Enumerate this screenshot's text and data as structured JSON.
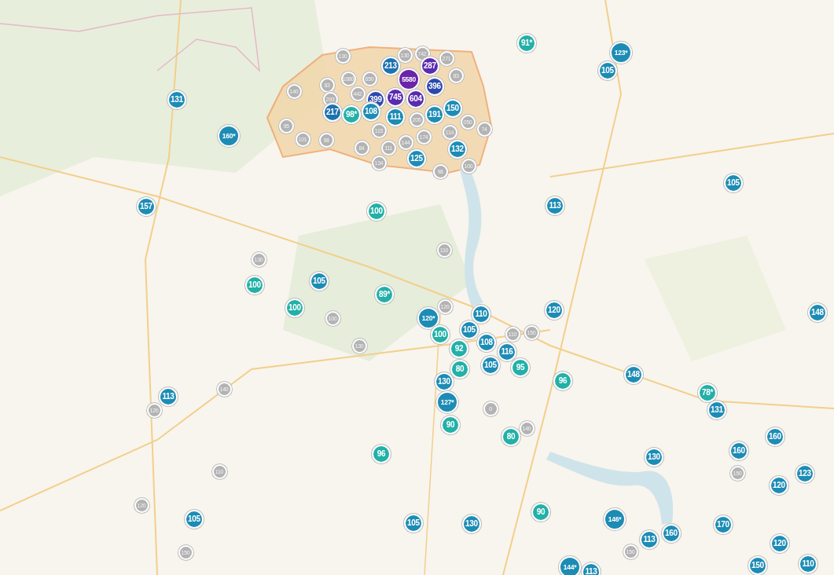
{
  "markers": [
    {
      "label": "131",
      "color": "#1d8cb5"
    },
    {
      "label": "160*",
      "color": "#1d8cb5"
    },
    {
      "label": "157",
      "color": "#1d8cb5"
    },
    {
      "label": "100",
      "color": "#22b0a7"
    },
    {
      "label": "130",
      "color": "#b3b3b3"
    },
    {
      "label": "100",
      "color": "#22b0a7"
    },
    {
      "label": "105",
      "color": "#1d8cb5"
    },
    {
      "label": "89*",
      "color": "#22b0a7"
    },
    {
      "label": "100",
      "color": "#22b0a7"
    },
    {
      "label": "100",
      "color": "#b3b3b3"
    },
    {
      "label": "130",
      "color": "#b3b3b3"
    },
    {
      "label": "130",
      "color": "#b3b3b3"
    },
    {
      "label": "130",
      "color": "#b3b3b3"
    },
    {
      "label": "742",
      "color": "#b3b3b3"
    },
    {
      "label": "271",
      "color": "#b3b3b3"
    },
    {
      "label": "83",
      "color": "#b3b3b3"
    },
    {
      "label": "83",
      "color": "#b3b3b3"
    },
    {
      "label": "1080",
      "color": "#b3b3b3"
    },
    {
      "label": "650",
      "color": "#b3b3b3"
    },
    {
      "label": "140",
      "color": "#b3b3b3"
    },
    {
      "label": "293",
      "color": "#b3b3b3"
    },
    {
      "label": "442",
      "color": "#b3b3b3"
    },
    {
      "label": "213",
      "color": "#1d72b0"
    },
    {
      "label": "399",
      "color": "#2c48ad"
    },
    {
      "label": "745",
      "color": "#5a2bb0"
    },
    {
      "label": "5580",
      "color": "#6a24a8"
    },
    {
      "label": "604",
      "color": "#5a2bb0"
    },
    {
      "label": "287",
      "color": "#5a2bb0"
    },
    {
      "label": "396",
      "color": "#2c48ad"
    },
    {
      "label": "217",
      "color": "#1d72b0"
    },
    {
      "label": "98*",
      "color": "#22b0a7"
    },
    {
      "label": "108",
      "color": "#1d8cb5"
    },
    {
      "label": "111",
      "color": "#1d8cb5"
    },
    {
      "label": "191",
      "color": "#1d8cb5"
    },
    {
      "label": "150",
      "color": "#1d8cb5"
    },
    {
      "label": "95",
      "color": "#b3b3b3"
    },
    {
      "label": "101",
      "color": "#b3b3b3"
    },
    {
      "label": "98",
      "color": "#b3b3b3"
    },
    {
      "label": "115",
      "color": "#b3b3b3"
    },
    {
      "label": "205",
      "color": "#b3b3b3"
    },
    {
      "label": "174",
      "color": "#b3b3b3"
    },
    {
      "label": "050",
      "color": "#b3b3b3"
    },
    {
      "label": "74",
      "color": "#b3b3b3"
    },
    {
      "label": "114",
      "color": "#b3b3b3"
    },
    {
      "label": "84",
      "color": "#b3b3b3"
    },
    {
      "label": "111",
      "color": "#b3b3b3"
    },
    {
      "label": "144",
      "color": "#b3b3b3"
    },
    {
      "label": "132",
      "color": "#1d8cb5"
    },
    {
      "label": "125",
      "color": "#1d8cb5"
    },
    {
      "label": "134",
      "color": "#b3b3b3"
    },
    {
      "label": "100",
      "color": "#b3b3b3"
    },
    {
      "label": "98",
      "color": "#b3b3b3"
    },
    {
      "label": "110",
      "color": "#b3b3b3"
    },
    {
      "label": "91*",
      "color": "#22b0a7"
    },
    {
      "label": "123*",
      "color": "#1d8cb5"
    },
    {
      "label": "105",
      "color": "#1d8cb5"
    },
    {
      "label": "105",
      "color": "#1d8cb5"
    },
    {
      "label": "113",
      "color": "#1d8cb5"
    },
    {
      "label": "120",
      "color": "#1d8cb5"
    },
    {
      "label": "148",
      "color": "#1d8cb5"
    },
    {
      "label": "120",
      "color": "#b3b3b3"
    },
    {
      "label": "120*",
      "color": "#1d8cb5"
    },
    {
      "label": "100",
      "color": "#22b0a7"
    },
    {
      "label": "110",
      "color": "#1d8cb5"
    },
    {
      "label": "150",
      "color": "#b3b3b3"
    },
    {
      "label": "110",
      "color": "#b3b3b3"
    },
    {
      "label": "105",
      "color": "#1d8cb5"
    },
    {
      "label": "92",
      "color": "#22b0a7"
    },
    {
      "label": "108",
      "color": "#1d8cb5"
    },
    {
      "label": "80",
      "color": "#22b0a7"
    },
    {
      "label": "105",
      "color": "#1d8cb5"
    },
    {
      "label": "95",
      "color": "#22b0a7"
    },
    {
      "label": "116",
      "color": "#1d8cb5"
    },
    {
      "label": "96",
      "color": "#22b0a7"
    },
    {
      "label": "148",
      "color": "#1d8cb5"
    },
    {
      "label": "78*",
      "color": "#22b0a7"
    },
    {
      "label": "131",
      "color": "#1d8cb5"
    },
    {
      "label": "130",
      "color": "#1d8cb5"
    },
    {
      "label": "127*",
      "color": "#1d8cb5"
    },
    {
      "label": "0",
      "color": "#b3b3b3"
    },
    {
      "label": "90",
      "color": "#22b0a7"
    },
    {
      "label": "140",
      "color": "#b3b3b3"
    },
    {
      "label": "80",
      "color": "#22b0a7"
    },
    {
      "label": "160",
      "color": "#1d8cb5"
    },
    {
      "label": "160",
      "color": "#1d8cb5"
    },
    {
      "label": "130",
      "color": "#1d8cb5"
    },
    {
      "label": "150",
      "color": "#b3b3b3"
    },
    {
      "label": "123",
      "color": "#1d8cb5"
    },
    {
      "label": "120",
      "color": "#1d8cb5"
    },
    {
      "label": "90",
      "color": "#22b0a7"
    },
    {
      "label": "130",
      "color": "#1d8cb5"
    },
    {
      "label": "146*",
      "color": "#1d8cb5"
    },
    {
      "label": "170",
      "color": "#1d8cb5"
    },
    {
      "label": "160",
      "color": "#1d8cb5"
    },
    {
      "label": "113",
      "color": "#1d8cb5"
    },
    {
      "label": "150",
      "color": "#b3b3b3"
    },
    {
      "label": "120",
      "color": "#1d8cb5"
    },
    {
      "label": "144*",
      "color": "#1d8cb5"
    },
    {
      "label": "113",
      "color": "#1d8cb5"
    },
    {
      "label": "150",
      "color": "#1d8cb5"
    },
    {
      "label": "110",
      "color": "#1d8cb5"
    },
    {
      "label": "140",
      "color": "#b3b3b3"
    },
    {
      "label": "120",
      "color": "#b3b3b3"
    },
    {
      "label": "113",
      "color": "#1d8cb5"
    },
    {
      "label": "110",
      "color": "#b3b3b3"
    },
    {
      "label": "120",
      "color": "#b3b3b3"
    },
    {
      "label": "105",
      "color": "#1d8cb5"
    },
    {
      "label": "150",
      "color": "#b3b3b3"
    },
    {
      "label": "96",
      "color": "#22b0a7"
    },
    {
      "label": "105",
      "color": "#1d8cb5"
    }
  ]
}
